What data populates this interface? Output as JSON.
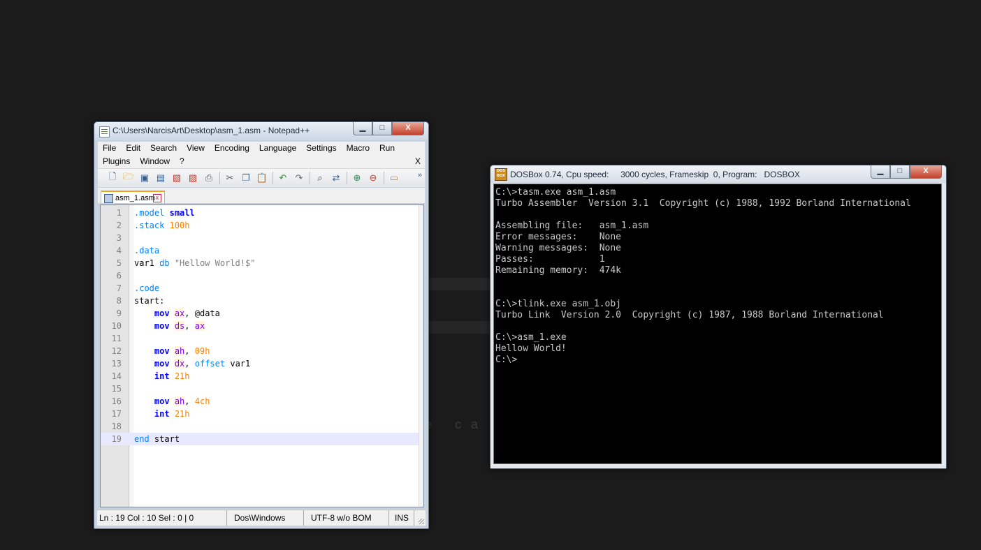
{
  "desktop": {
    "faded_text": "e ca"
  },
  "notepad": {
    "title": "C:\\Users\\NarcisArt\\Desktop\\asm_1.asm - Notepad++",
    "window_buttons": {
      "minimize": "▁",
      "maximize": "□",
      "close": "X"
    },
    "menu_row1": [
      "File",
      "Edit",
      "Search",
      "View",
      "Encoding",
      "Language",
      "Settings",
      "Macro",
      "Run"
    ],
    "menu_row2": [
      "Plugins",
      "Window",
      "?"
    ],
    "menu_close": "X",
    "toolbar_icons": [
      "new-file-icon",
      "open-file-icon",
      "save-icon",
      "save-all-icon",
      "close-icon",
      "close-all-icon",
      "print-icon",
      "cut-icon",
      "copy-icon",
      "paste-icon",
      "undo-icon",
      "redo-icon",
      "find-icon",
      "replace-icon",
      "zoom-in-icon",
      "zoom-out-icon",
      "sync-icon"
    ],
    "toolbar_more": "»",
    "tab": {
      "label": "asm_1.asm",
      "close": "x"
    },
    "code_lines": [
      {
        "n": "1",
        "text": ".model small"
      },
      {
        "n": "2",
        "text": ".stack 100h"
      },
      {
        "n": "3",
        "text": ""
      },
      {
        "n": "4",
        "text": ".data"
      },
      {
        "n": "5",
        "text": "var1 db \"Hellow World!$\""
      },
      {
        "n": "6",
        "text": ""
      },
      {
        "n": "7",
        "text": ".code"
      },
      {
        "n": "8",
        "text": "start:"
      },
      {
        "n": "9",
        "text": "    mov ax, @data"
      },
      {
        "n": "10",
        "text": "    mov ds, ax"
      },
      {
        "n": "11",
        "text": ""
      },
      {
        "n": "12",
        "text": "    mov ah, 09h"
      },
      {
        "n": "13",
        "text": "    mov dx, offset var1"
      },
      {
        "n": "14",
        "text": "    int 21h"
      },
      {
        "n": "15",
        "text": ""
      },
      {
        "n": "16",
        "text": "    mov ah, 4ch"
      },
      {
        "n": "17",
        "text": "    int 21h"
      },
      {
        "n": "18",
        "text": ""
      },
      {
        "n": "19",
        "text": "end start"
      }
    ],
    "current_line": "19",
    "status": {
      "position": "Ln : 19    Col : 10    Sel : 0 | 0",
      "eol": "Dos\\Windows",
      "encoding": "UTF-8 w/o BOM",
      "mode": "INS"
    }
  },
  "dosbox": {
    "title": "DOSBox 0.74, Cpu speed:     3000 cycles, Frameskip  0, Program:   DOSBOX",
    "icon_text": "DOS BOX",
    "window_buttons": {
      "minimize": "▁",
      "maximize": "□",
      "close": "X"
    },
    "console_lines": [
      "C:\\>tasm.exe asm_1.asm",
      "Turbo Assembler  Version 3.1  Copyright (c) 1988, 1992 Borland International",
      "",
      "Assembling file:   asm_1.asm",
      "Error messages:    None",
      "Warning messages:  None",
      "Passes:            1",
      "Remaining memory:  474k",
      "",
      "",
      "C:\\>tlink.exe asm_1.obj",
      "Turbo Link  Version 2.0  Copyright (c) 1987, 1988 Borland International",
      "",
      "C:\\>asm_1.exe",
      "Hellow World!",
      "C:\\>"
    ]
  }
}
